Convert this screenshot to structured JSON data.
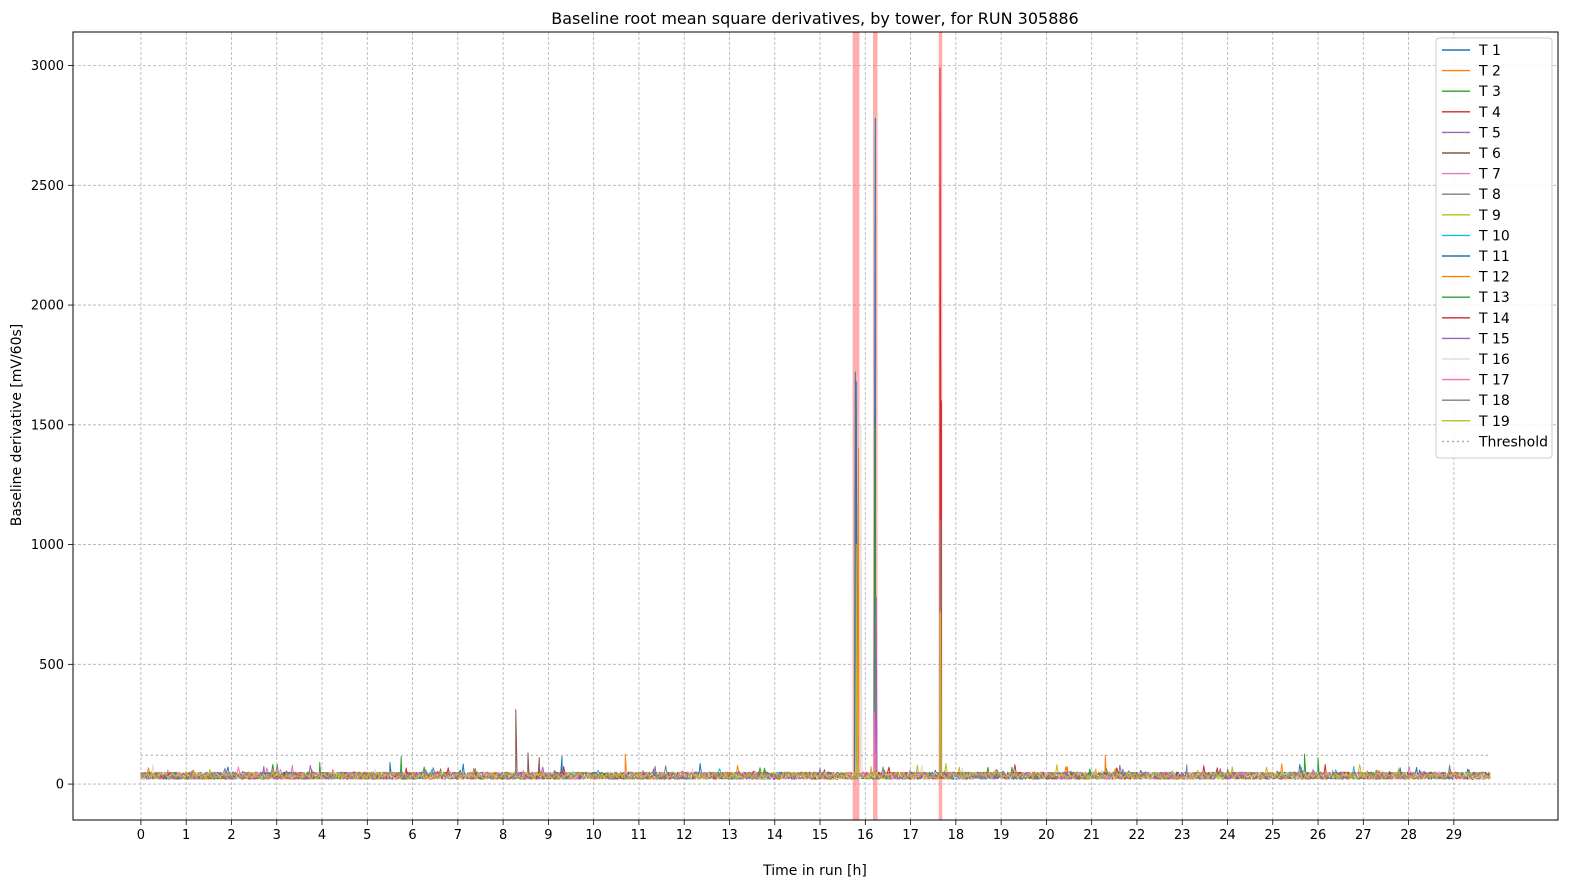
{
  "chart_data": {
    "type": "line",
    "title": "Baseline root mean square derivatives, by tower, for RUN 305886",
    "xlabel": "Time in run [h]",
    "ylabel": "Baseline derivative [mV/60s]",
    "xlim": [
      -1.5,
      31.3
    ],
    "ylim": [
      -150,
      3140
    ],
    "x_ticks": [
      0,
      1,
      2,
      3,
      4,
      5,
      6,
      7,
      8,
      9,
      10,
      11,
      12,
      13,
      14,
      15,
      16,
      17,
      18,
      19,
      20,
      21,
      22,
      23,
      24,
      25,
      26,
      27,
      28,
      29
    ],
    "y_ticks": [
      0,
      500,
      1000,
      1500,
      2000,
      2500,
      3000
    ],
    "grid": true,
    "legend_position": "top-right",
    "x_range": [
      0,
      29.8
    ],
    "baseline_level": 35,
    "threshold": {
      "name": "Threshold",
      "value": 120,
      "color": "#aaaaaa"
    },
    "highlight_bands": [
      {
        "x0": 15.72,
        "x1": 15.87,
        "color": "#ff7777"
      },
      {
        "x0": 16.17,
        "x1": 16.27,
        "color": "#ff7777"
      },
      {
        "x0": 17.62,
        "x1": 17.7,
        "color": "#ff7777"
      }
    ],
    "series": [
      {
        "name": "T 1",
        "color": "#1f77b4",
        "peaks": [
          [
            15.78,
            1720
          ],
          [
            16.22,
            2780
          ],
          [
            5.5,
            90
          ]
        ]
      },
      {
        "name": "T 2",
        "color": "#ff7f0e",
        "peaks": [
          [
            15.8,
            1600
          ],
          [
            10.7,
            125
          ],
          [
            21.3,
            120
          ]
        ]
      },
      {
        "name": "T 3",
        "color": "#2ca02c",
        "peaks": [
          [
            16.22,
            1500
          ],
          [
            17.65,
            1050
          ],
          [
            5.75,
            115
          ],
          [
            26.0,
            110
          ]
        ]
      },
      {
        "name": "T 4",
        "color": "#d62728",
        "peaks": [
          [
            17.65,
            2990
          ],
          [
            15.82,
            600
          ]
        ]
      },
      {
        "name": "T 5",
        "color": "#9467bd",
        "peaks": [
          [
            16.24,
            780
          ],
          [
            23.1,
            80
          ]
        ]
      },
      {
        "name": "T 6",
        "color": "#8c564b",
        "peaks": [
          [
            8.28,
            310
          ],
          [
            8.55,
            130
          ],
          [
            8.8,
            110
          ]
        ]
      },
      {
        "name": "T 7",
        "color": "#e377c2",
        "peaks": [
          [
            15.85,
            200
          ]
        ]
      },
      {
        "name": "T 8",
        "color": "#7f7f7f",
        "peaks": [
          [
            15.8,
            900
          ]
        ]
      },
      {
        "name": "T 9",
        "color": "#bcbd22",
        "peaks": [
          [
            15.8,
            1560
          ],
          [
            17.65,
            710
          ],
          [
            16.2,
            180
          ]
        ]
      },
      {
        "name": "T 10",
        "color": "#17becf",
        "peaks": [
          [
            9.3,
            110
          ]
        ]
      },
      {
        "name": "T 11",
        "color": "#1f77b4",
        "peaks": [
          [
            15.8,
            1680
          ],
          [
            9.3,
            115
          ]
        ]
      },
      {
        "name": "T 12",
        "color": "#ff7f0e",
        "peaks": [
          [
            15.85,
            1400
          ]
        ]
      },
      {
        "name": "T 13",
        "color": "#2ca02c",
        "peaks": [
          [
            25.7,
            125
          ],
          [
            3.95,
            90
          ]
        ]
      },
      {
        "name": "T 14",
        "color": "#d62728",
        "peaks": [
          [
            17.68,
            1600
          ]
        ]
      },
      {
        "name": "T 15",
        "color": "#9467bd",
        "peaks": [
          [
            16.23,
            700
          ]
        ]
      },
      {
        "name": "T 16",
        "color": "#dddddd",
        "peaks": [
          [
            15.9,
            1500
          ]
        ]
      },
      {
        "name": "T 17",
        "color": "#ff69b4",
        "peaks": [
          [
            16.2,
            300
          ]
        ]
      },
      {
        "name": "T 18",
        "color": "#7f7f7f",
        "peaks": [
          [
            17.66,
            1100
          ]
        ]
      },
      {
        "name": "T 19",
        "color": "#bcbd22",
        "peaks": [
          [
            15.8,
            1000
          ],
          [
            17.66,
            720
          ]
        ]
      }
    ]
  }
}
